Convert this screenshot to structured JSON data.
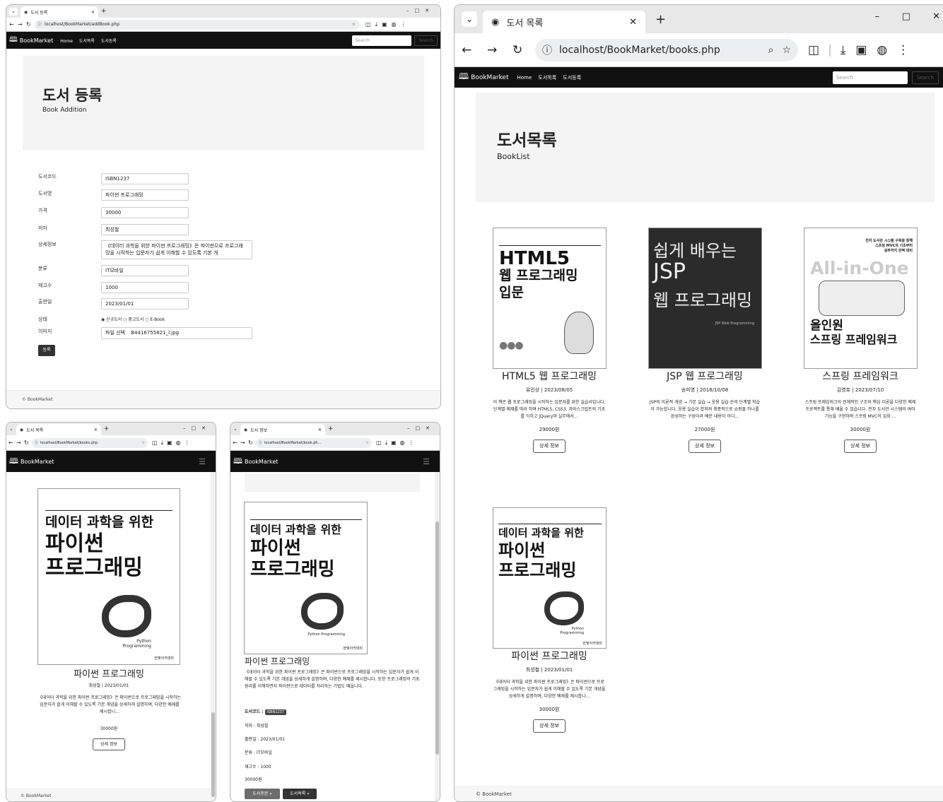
{
  "win1": {
    "tab_title": "도서 등록",
    "url": "localhost/BookMarket/addBook.php",
    "nav": {
      "brand": "BookMarket",
      "links": [
        "Home",
        "도서목록",
        "도서등록"
      ],
      "search_placeholder": "Search",
      "search_button": "Search"
    },
    "jumbo": {
      "title": "도서 등록",
      "subtitle": "Book Addition"
    },
    "form": {
      "labels": [
        "도서코드",
        "도서명",
        "가격",
        "저자",
        "상세정보",
        "분류",
        "재고수",
        "출판일",
        "상태",
        "이미지"
      ],
      "bookId": "ISBN1237",
      "name": "파이썬 프로그래밍",
      "price": "30000",
      "author": "최성철",
      "description": "《데이터 과학을 위한 파이썬 프로그래밍》은 파이썬으로 프로그래밍을 시작하는 입문자가 쉽게 이해할 수 있도록 기본 개",
      "category": "IT모바일",
      "stock": "1000",
      "release": "2023/01/01",
      "condition_options": [
        "신규도서",
        "중고도서",
        "E-Book"
      ],
      "file_button": "파일 선택",
      "file_name": "B4416755821_l.jpg",
      "submit": "등록"
    },
    "footer": "© BookMarket"
  },
  "win2": {
    "tab_title": "도서 목록",
    "url": "localhost/BookMarket/books.php",
    "brand": "BookMarket",
    "book": {
      "title": "파이썬 프로그래밍",
      "meta": "최성철 | 2023/01/01",
      "desc": "《데이터 과학을 위한 파이썬 프로그래밍》은 파이썬으로 프로그래밍을 시작하는 입문자가 쉽게 이해할 수 있도록 기본 개념을 상세하게 설명하며, 다양한 예제를 제시합니...",
      "price": "30000원",
      "button": "상세 정보"
    },
    "footer": "© BookMarket"
  },
  "win3": {
    "tab_title": "도서 정보",
    "url": "localhost/BookMarket/book.ph...",
    "brand": "BookMarket",
    "title": "파이썬 프로그래밍",
    "desc": "《데이터 과학을 위한 파이썬 프로그래밍》은 파이썬으로 프로그래밍을 시작하는 입문자가 쉽게 이해할 수 있도록 기본 개념을 상세하게 설명하며, 다양한 예제를 제시합니다. 또한 프로그래밍의 기초 원리를 이해하면서 파이썬으로 데이터를 처리하는 기법도 배웁니다.",
    "code_label": "도서코드 :",
    "code": "ISBN1237",
    "author": "저자 : 최성철",
    "release": "출판일 : 2023/01/01",
    "category": "분류 : IT모바일",
    "stock": "재고수 : 1000",
    "price": "30000원",
    "order_button": "도서주문 »",
    "list_button": "도서목록 »"
  },
  "win4": {
    "tab_title": "도서 목록",
    "url": "localhost/BookMarket/books.php",
    "nav": {
      "brand": "BookMarket",
      "links": [
        "Home",
        "도서목록",
        "도서등록"
      ],
      "search_placeholder": "Search",
      "search_button": "Search"
    },
    "jumbo": {
      "title": "도서목록",
      "subtitle": "BookList"
    },
    "books": [
      {
        "title": "HTML5 웹 프로그래밍",
        "meta": "유인상 | 2023/08/05",
        "desc": "이 책은 웹 프로그래밍을 시작하는 입문자를 위한 실습서입니다. 단계별 예제를 따라 하며 HTML5, CSS3, 자바스크립트의 기초를 익히고 jQuery와 실무에서...",
        "price": "29000원",
        "button": "상세 정보"
      },
      {
        "title": "JSP 웹 프로그래밍",
        "meta": "송미영 | 2018/10/08",
        "desc": "JSP의 이론적 개념 → 기본 실습 → 응용 실습 순의 단계별 학습이 가능합니다. 응용 실습이 합쳐져 최종적으로 쇼핑몰 하나를 완성하는 구성이라 배운 내용이 어디...",
        "price": "27000원",
        "button": "상세 정보"
      },
      {
        "title": "스프링 프레임워크",
        "meta": "김영호 | 2023/07/10",
        "desc": "스프링 프레임워크의 전체적인 구조와 핵심 이론을 다양한 예제 프로젝트를 통해 배울 수 있습니다. 전자 도서관 시스템의 여러 기능을 구현하며 스프링 MVC의 심화 ...",
        "price": "30000원",
        "button": "상세 정보"
      },
      {
        "title": "파이썬 프로그래밍",
        "meta": "최성철 | 2023/01/01",
        "desc": "《데이터 과학을 위한 파이썬 프로그래밍》은 파이썬으로 프로그래밍을 시작하는 입문자가 쉽게 이해할 수 있도록 기본 개념을 상세하게 설명하며, 다양한 예제를 제시합니...",
        "price": "30000원",
        "button": "상세 정보"
      }
    ],
    "footer": "© BookMarket"
  },
  "covers": {
    "python": {
      "top": "데이터 과학을 위한",
      "l1": "파이썬",
      "l2": "프로그래밍",
      "py": "Python Programming",
      "publisher": "한빛아카데미"
    },
    "html5": {
      "l1": "HTML5",
      "l2": "웹 프로그래밍",
      "l3": "입문"
    },
    "jsp": {
      "l1": "쉽게 배우는",
      "l2": "JSP",
      "l3": "웹 프로그래밍",
      "en": "JSP Web Programming"
    },
    "spring": {
      "top1": "전자 도서관 시스템 구축을 통해",
      "top2": "스프링 MVC의 기초부터",
      "top3": "실무까지 완벽 대비",
      "big": "All-in-One",
      "l1": "올인원",
      "l2": "스프링 프레임워크"
    }
  }
}
